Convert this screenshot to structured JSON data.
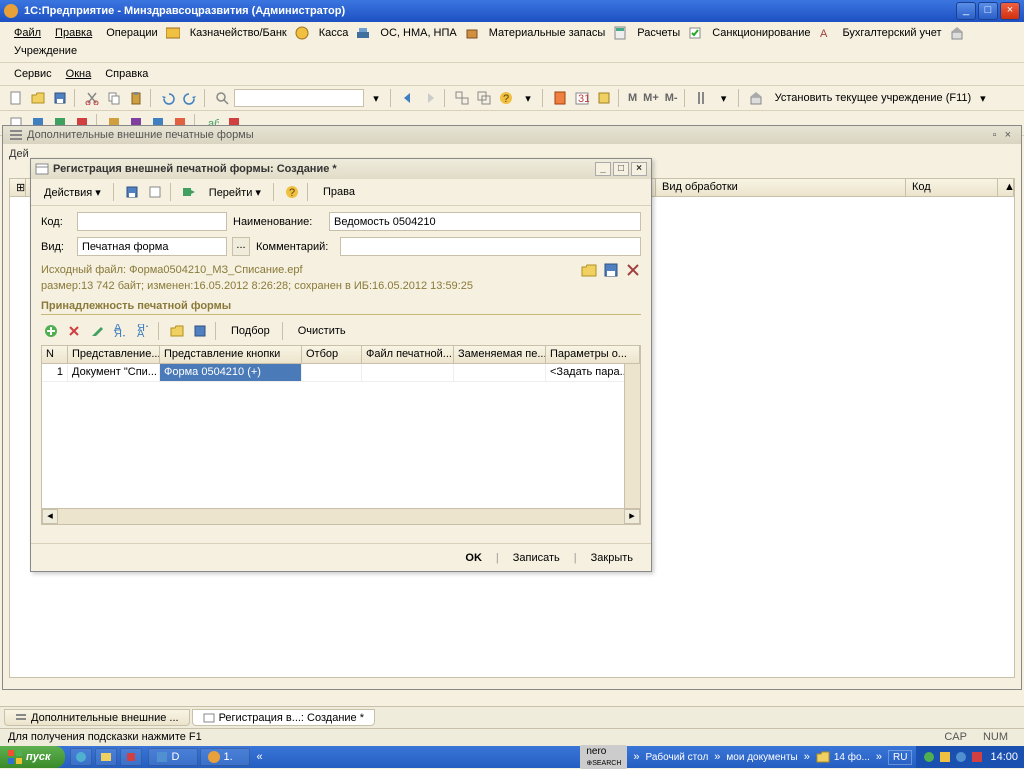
{
  "app": {
    "title": "1С:Предприятие  - Минздравсоцразвития (Администратор)"
  },
  "menu": {
    "file": "Файл",
    "edit": "Правка",
    "operations": "Операции",
    "treasury": "Казначейство/Банк",
    "cashbox": "Касса",
    "os": "ОС, НМА, НПА",
    "materials": "Материальные запасы",
    "calc": "Расчеты",
    "sanction": "Санкционирование",
    "accounting": "Бухгалтерский учет",
    "institution": "Учреждение",
    "service": "Сервис",
    "windows": "Окна",
    "help": "Справка"
  },
  "toolbar2": {
    "set_current": "Установить текущее учреждение (F11)",
    "m": "М",
    "mplus": "М+",
    "mminus": "М-"
  },
  "bg_window": {
    "title": "Дополнительные внешние печатные формы",
    "left_header_prefix": "Дей",
    "cols": {
      "processing": "Вид обработки",
      "code": "Код"
    }
  },
  "dialog": {
    "title": "Регистрация внешней печатной формы: Создание *",
    "actions": "Действия",
    "goto": "Перейти",
    "rights": "Права",
    "lbl_code": "Код:",
    "lbl_name": "Наименование:",
    "val_name": "Ведомость 0504210",
    "lbl_type": "Вид:",
    "val_type": "Печатная форма",
    "lbl_comment": "Комментарий:",
    "info_line1": "Исходный файл: Форма0504210_МЗ_Списание.epf",
    "info_line2": "размер:13 742 байт; изменен:16.05.2012 8:26:28; сохранен в ИБ:16.05.2012 13:59:25",
    "section": "Принадлежность печатной формы",
    "grid_tb": {
      "pick": "Подбор",
      "clear": "Очистить"
    },
    "grid_cols": {
      "n": "N",
      "repr": "Представление...",
      "btn_repr": "Представление кнопки",
      "filter": "Отбор",
      "print_file": "Файл печатной...",
      "replace": "Заменяемая пе...",
      "params": "Параметры о..."
    },
    "grid_row": {
      "n": "1",
      "repr": "Документ \"Спи...",
      "btn_repr": "Форма 0504210 (+)",
      "params": "<Задать пара..."
    },
    "footer": {
      "ok": "OK",
      "write": "Записать",
      "close": "Закрыть"
    }
  },
  "tabs": {
    "t1": "Дополнительные внешние ...",
    "t2": "Регистрация в...: Создание *"
  },
  "status": {
    "hint": "Для получения подсказки нажмите F1",
    "cap": "CAP",
    "num": "NUM"
  },
  "taskbar": {
    "start": "пуск",
    "tasks": {
      "d": "D",
      "one": "1."
    },
    "mid": {
      "desktop": "Рабочий стол",
      "docs": "мои документы",
      "folder": "14 фо..."
    },
    "lang": "RU",
    "time": "14:00"
  }
}
